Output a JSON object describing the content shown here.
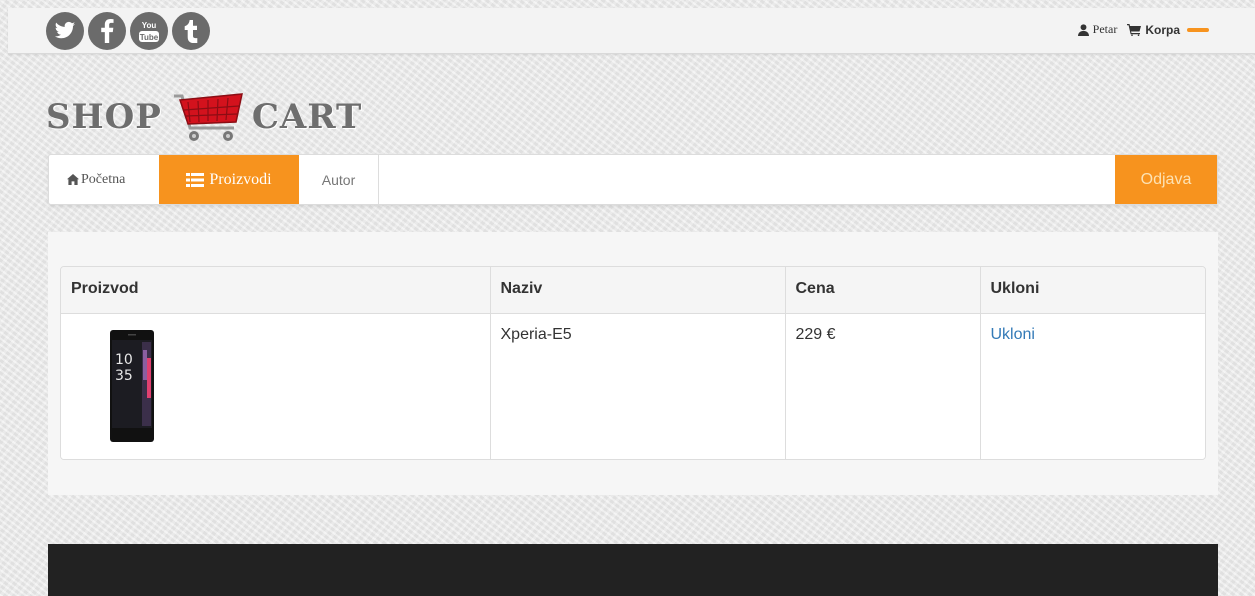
{
  "social": [
    {
      "icon": "twitter-icon"
    },
    {
      "icon": "facebook-icon"
    },
    {
      "icon": "youtube-icon",
      "label_top": "You",
      "label_bottom": "Tube"
    },
    {
      "icon": "tumblr-icon"
    }
  ],
  "user": {
    "name": "Petar",
    "icon": "user-icon"
  },
  "cart": {
    "label": "Korpa",
    "icon": "cart-icon"
  },
  "logo": {
    "left": "SHOP",
    "right": "CART"
  },
  "nav": {
    "home": "Početna",
    "products": "Proizvodi",
    "author": "Autor",
    "logout": "Odjava"
  },
  "table": {
    "headers": [
      "Proizvod",
      "Naziv",
      "Cena",
      "Ukloni"
    ],
    "rows": [
      {
        "phone_time_top": "10",
        "phone_time_bottom": "35",
        "name": "Xperia-E5",
        "price": "229 €",
        "remove": "Ukloni"
      }
    ]
  },
  "colors": {
    "accent": "#f7931e",
    "footer": "#222222",
    "link": "#337ab7"
  }
}
